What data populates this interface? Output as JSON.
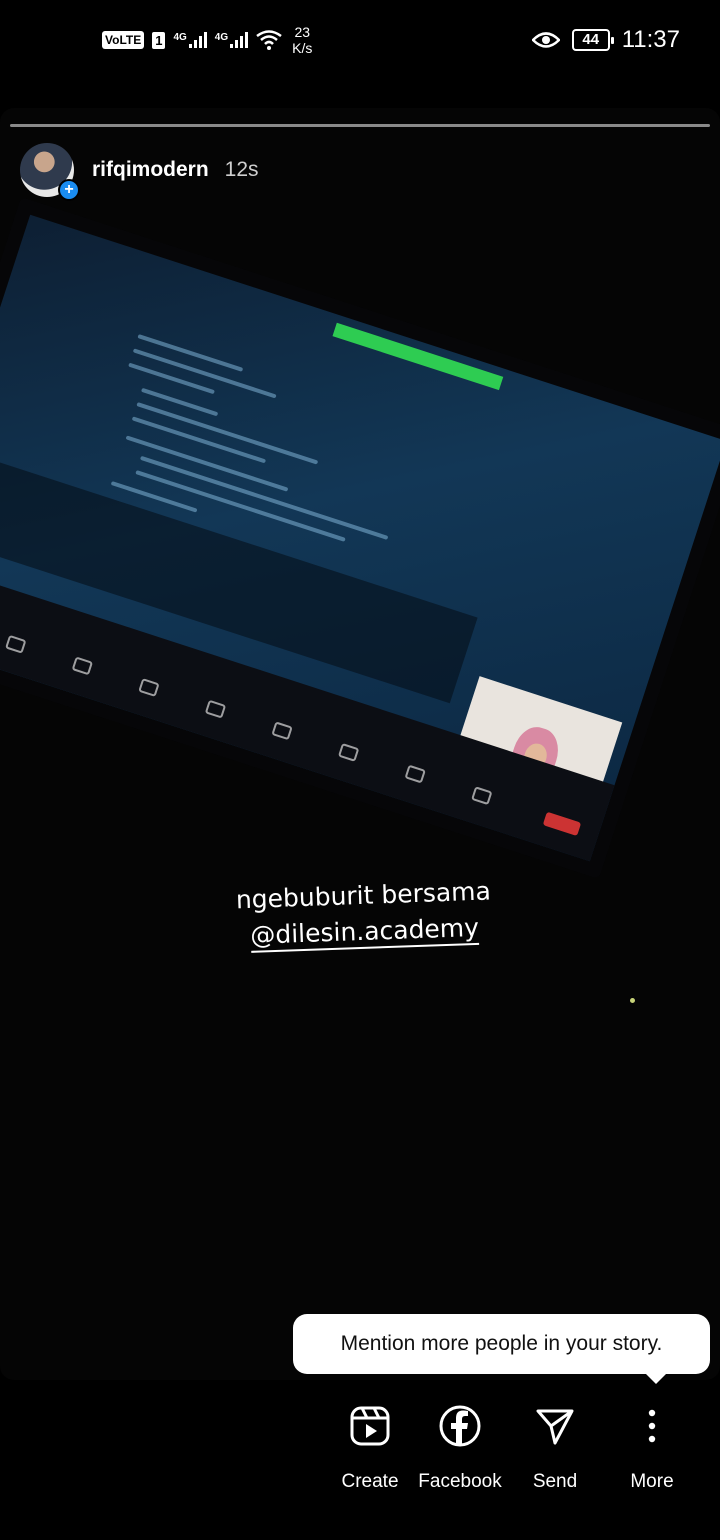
{
  "status_bar": {
    "volte": "VoLTE",
    "sim": "1",
    "net1": "4G",
    "net2": "4G",
    "speed_value": "23",
    "speed_unit": "K/s",
    "battery": "44",
    "time": "11:37"
  },
  "story": {
    "username": "rifqimodern",
    "elapsed": "12s",
    "caption_line1": "ngebuburit bersama",
    "caption_mention": "@dilesin.academy"
  },
  "tooltip": {
    "text": "Mention more people in your story."
  },
  "actions": [
    {
      "label": "Create",
      "icon": "reels-icon"
    },
    {
      "label": "Facebook",
      "icon": "facebook-icon"
    },
    {
      "label": "Send",
      "icon": "send-icon"
    },
    {
      "label": "More",
      "icon": "more-icon"
    }
  ]
}
